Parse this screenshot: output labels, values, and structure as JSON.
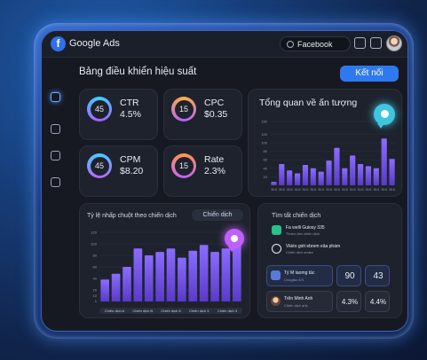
{
  "app": {
    "title": "Google Ads",
    "logo_letter": "f"
  },
  "topbar": {
    "search_value": "Facebook"
  },
  "header": {
    "title": "Bảng điều khiển hiệu suất",
    "connect_label": "Kết nối"
  },
  "stats": [
    {
      "label": "CTR",
      "value": "4.5%",
      "ring_number": "45",
      "ring_colors": [
        "#3fd0ff",
        "#a860ff"
      ]
    },
    {
      "label": "CPC",
      "value": "$0.35",
      "ring_number": "15",
      "ring_colors": [
        "#ffb040",
        "#b060ff"
      ]
    },
    {
      "label": "CPM",
      "value": "$8.20",
      "ring_number": "45",
      "ring_colors": [
        "#3fd0ff",
        "#c060ff"
      ]
    },
    {
      "label": "Rate",
      "value": "2.3%",
      "ring_number": "15",
      "ring_colors": [
        "#ff9a40",
        "#c060ff"
      ]
    }
  ],
  "impressions": {
    "title": "Tổng quan về ấn tượng",
    "chart_data": {
      "type": "bar",
      "categories": [
        "30:6",
        "30:6",
        "30:6",
        "30:6",
        "30:6",
        "30:6",
        "30:6",
        "30:6",
        "30:6",
        "30:6",
        "30:6",
        "30:6",
        "30:6",
        "30:6",
        "30:6",
        "30:6"
      ],
      "values": [
        8,
        50,
        35,
        28,
        48,
        40,
        32,
        58,
        88,
        40,
        70,
        50,
        45,
        40,
        110,
        62
      ],
      "yticks": [
        20,
        40,
        60,
        80,
        100,
        120,
        150
      ],
      "ylim": [
        0,
        150
      ]
    }
  },
  "ctr_chart": {
    "title": "Tỷ lệ nhấp chuột theo chiến dịch",
    "filter_label": "Chiến dịch",
    "chart_data": {
      "type": "bar",
      "values": [
        38,
        48,
        60,
        92,
        80,
        86,
        92,
        76,
        88,
        98,
        86,
        92,
        100
      ],
      "yticks": [
        1,
        10,
        20,
        40,
        60,
        80,
        100,
        120
      ],
      "ylim": [
        0,
        120
      ],
      "x_labels": [
        "Chiến dịch A",
        "Chiến dịch B",
        "Chiến dịch 8",
        "Chiến dịch 3",
        "Chiến dịch 3"
      ]
    }
  },
  "find_campaign": {
    "title": "Tìm tất chiến dịch",
    "items": [
      {
        "title": "Fa welli Guiosy 335",
        "sub": "Tlmen dén chiến dịch",
        "icon_color": "#29c08a"
      },
      {
        "title": "Vkiéo giét ebrem eâa phám",
        "sub": "Chiến dịch ondez",
        "icon_color": "#e8ecf5"
      }
    ],
    "metric_rows": [
      {
        "name": "Tý M Iaomg tác",
        "sub": "Chugtáo 8/3",
        "values": [
          "90",
          "43"
        ]
      },
      {
        "name": "Trẽn Minh Anh",
        "sub": "Chiến dịch arfs",
        "values": [
          "4.3%",
          "4.4%"
        ]
      }
    ]
  },
  "colors": {
    "accent": "#2f79f0",
    "bar_top": "#8a6cff",
    "bar_bottom": "#5a3ac8",
    "bubble": "#3ec6e0",
    "bubble2": "#c060ff"
  }
}
